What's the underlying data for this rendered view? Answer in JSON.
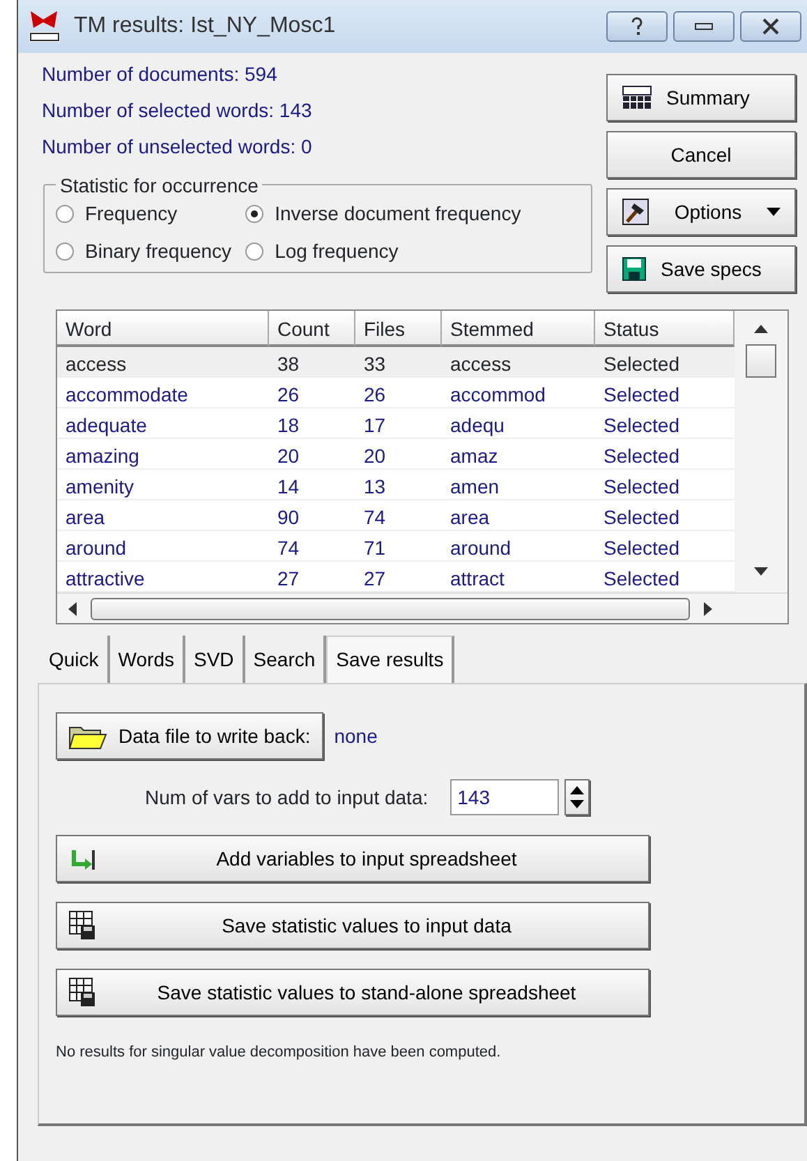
{
  "window": {
    "title": "TM results: Ist_NY_Mosc1"
  },
  "info": [
    "Number of documents: 594",
    "Number of selected words: 143",
    "Number of unselected words: 0"
  ],
  "side_buttons": [
    {
      "label": "Summary",
      "kind": "summary"
    },
    {
      "label": "Cancel",
      "kind": "plain"
    },
    {
      "label": "Options",
      "kind": "options"
    },
    {
      "label": "Save specs",
      "kind": "save"
    }
  ],
  "statistic": {
    "title": "Statistic for occurrence",
    "options": [
      {
        "label": "Frequency",
        "selected": false
      },
      {
        "label": "Inverse document frequency",
        "selected": true
      },
      {
        "label": "Binary frequency",
        "selected": false
      },
      {
        "label": "Log frequency",
        "selected": false
      }
    ]
  },
  "table": {
    "columns": [
      "Word",
      "Count",
      "Files",
      "Stemmed",
      "Status"
    ],
    "rows": [
      {
        "cells": [
          "access",
          "38",
          "33",
          "access",
          "Selected"
        ],
        "selected": true
      },
      {
        "cells": [
          "accommodate",
          "26",
          "26",
          "accommod",
          "Selected"
        ],
        "selected": false
      },
      {
        "cells": [
          "adequate",
          "18",
          "17",
          "adequ",
          "Selected"
        ],
        "selected": false
      },
      {
        "cells": [
          "amazing",
          "20",
          "20",
          "amaz",
          "Selected"
        ],
        "selected": false
      },
      {
        "cells": [
          "amenity",
          "14",
          "13",
          "amen",
          "Selected"
        ],
        "selected": false
      },
      {
        "cells": [
          "area",
          "90",
          "74",
          "area",
          "Selected"
        ],
        "selected": false
      },
      {
        "cells": [
          "around",
          "74",
          "71",
          "around",
          "Selected"
        ],
        "selected": false
      },
      {
        "cells": [
          "attractive",
          "27",
          "27",
          "attract",
          "Selected"
        ],
        "selected": false
      }
    ]
  },
  "tabs": [
    {
      "label": "Quick",
      "selected": false
    },
    {
      "label": "Words",
      "selected": false
    },
    {
      "label": "SVD",
      "selected": false
    },
    {
      "label": "Search",
      "selected": false
    },
    {
      "label": "Save results",
      "selected": true
    }
  ],
  "save_results": {
    "data_file_button": "Data file to write back:",
    "data_file": "none",
    "num_vars_label": "Num of vars to add to input data:",
    "num_vars": "143",
    "actions": [
      {
        "label": "Add variables to input spreadsheet",
        "kind": "add"
      },
      {
        "label": "Save statistic values to input data",
        "kind": "grid"
      },
      {
        "label": "Save statistic values to stand-alone spreadsheet",
        "kind": "grid"
      }
    ],
    "note": "No results for singular value decomposition have been computed."
  }
}
